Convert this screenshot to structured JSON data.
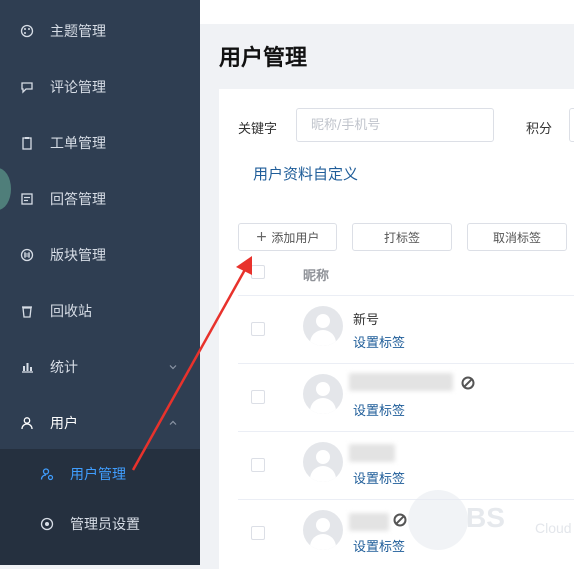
{
  "sidebar": {
    "items": [
      {
        "label": "主题管理",
        "icon": "palette-icon"
      },
      {
        "label": "评论管理",
        "icon": "comment-icon"
      },
      {
        "label": "工单管理",
        "icon": "clipboard-icon"
      },
      {
        "label": "回答管理",
        "icon": "answer-icon"
      },
      {
        "label": "版块管理",
        "icon": "section-icon"
      },
      {
        "label": "回收站",
        "icon": "trash-icon"
      },
      {
        "label": "统计",
        "icon": "chart-icon"
      },
      {
        "label": "用户",
        "icon": "user-icon"
      }
    ],
    "submenu": [
      {
        "label": "用户管理",
        "icon": "user-manage-icon",
        "selected": true
      },
      {
        "label": "管理员设置",
        "icon": "admin-icon",
        "selected": false
      }
    ],
    "accent_color": "#409eff",
    "bg_color": "#2f3e52"
  },
  "main": {
    "title": "用户管理",
    "filters": {
      "keyword_label": "关键字",
      "keyword_placeholder": "昵称/手机号",
      "score_label": "积分"
    },
    "custom_link": "用户资料自定义",
    "buttons": {
      "add_user": "添加用户",
      "tag": "打标签",
      "untag": "取消标签"
    },
    "table": {
      "column_nickname": "昵称",
      "rows": [
        {
          "name": "新号",
          "action": "设置标签",
          "name_blurred": false,
          "banned": false
        },
        {
          "name": "",
          "action": "设置标签",
          "name_blurred": true,
          "banned": true
        },
        {
          "name": "",
          "action": "设置标签",
          "name_blurred": true,
          "banned": false
        },
        {
          "name": "",
          "action": "设置标签",
          "name_blurred": true,
          "banned": true
        }
      ]
    }
  },
  "watermark": {
    "text": "BS",
    "subtext": "Cloud"
  },
  "annotation": {
    "arrow_color": "#e8322c"
  }
}
